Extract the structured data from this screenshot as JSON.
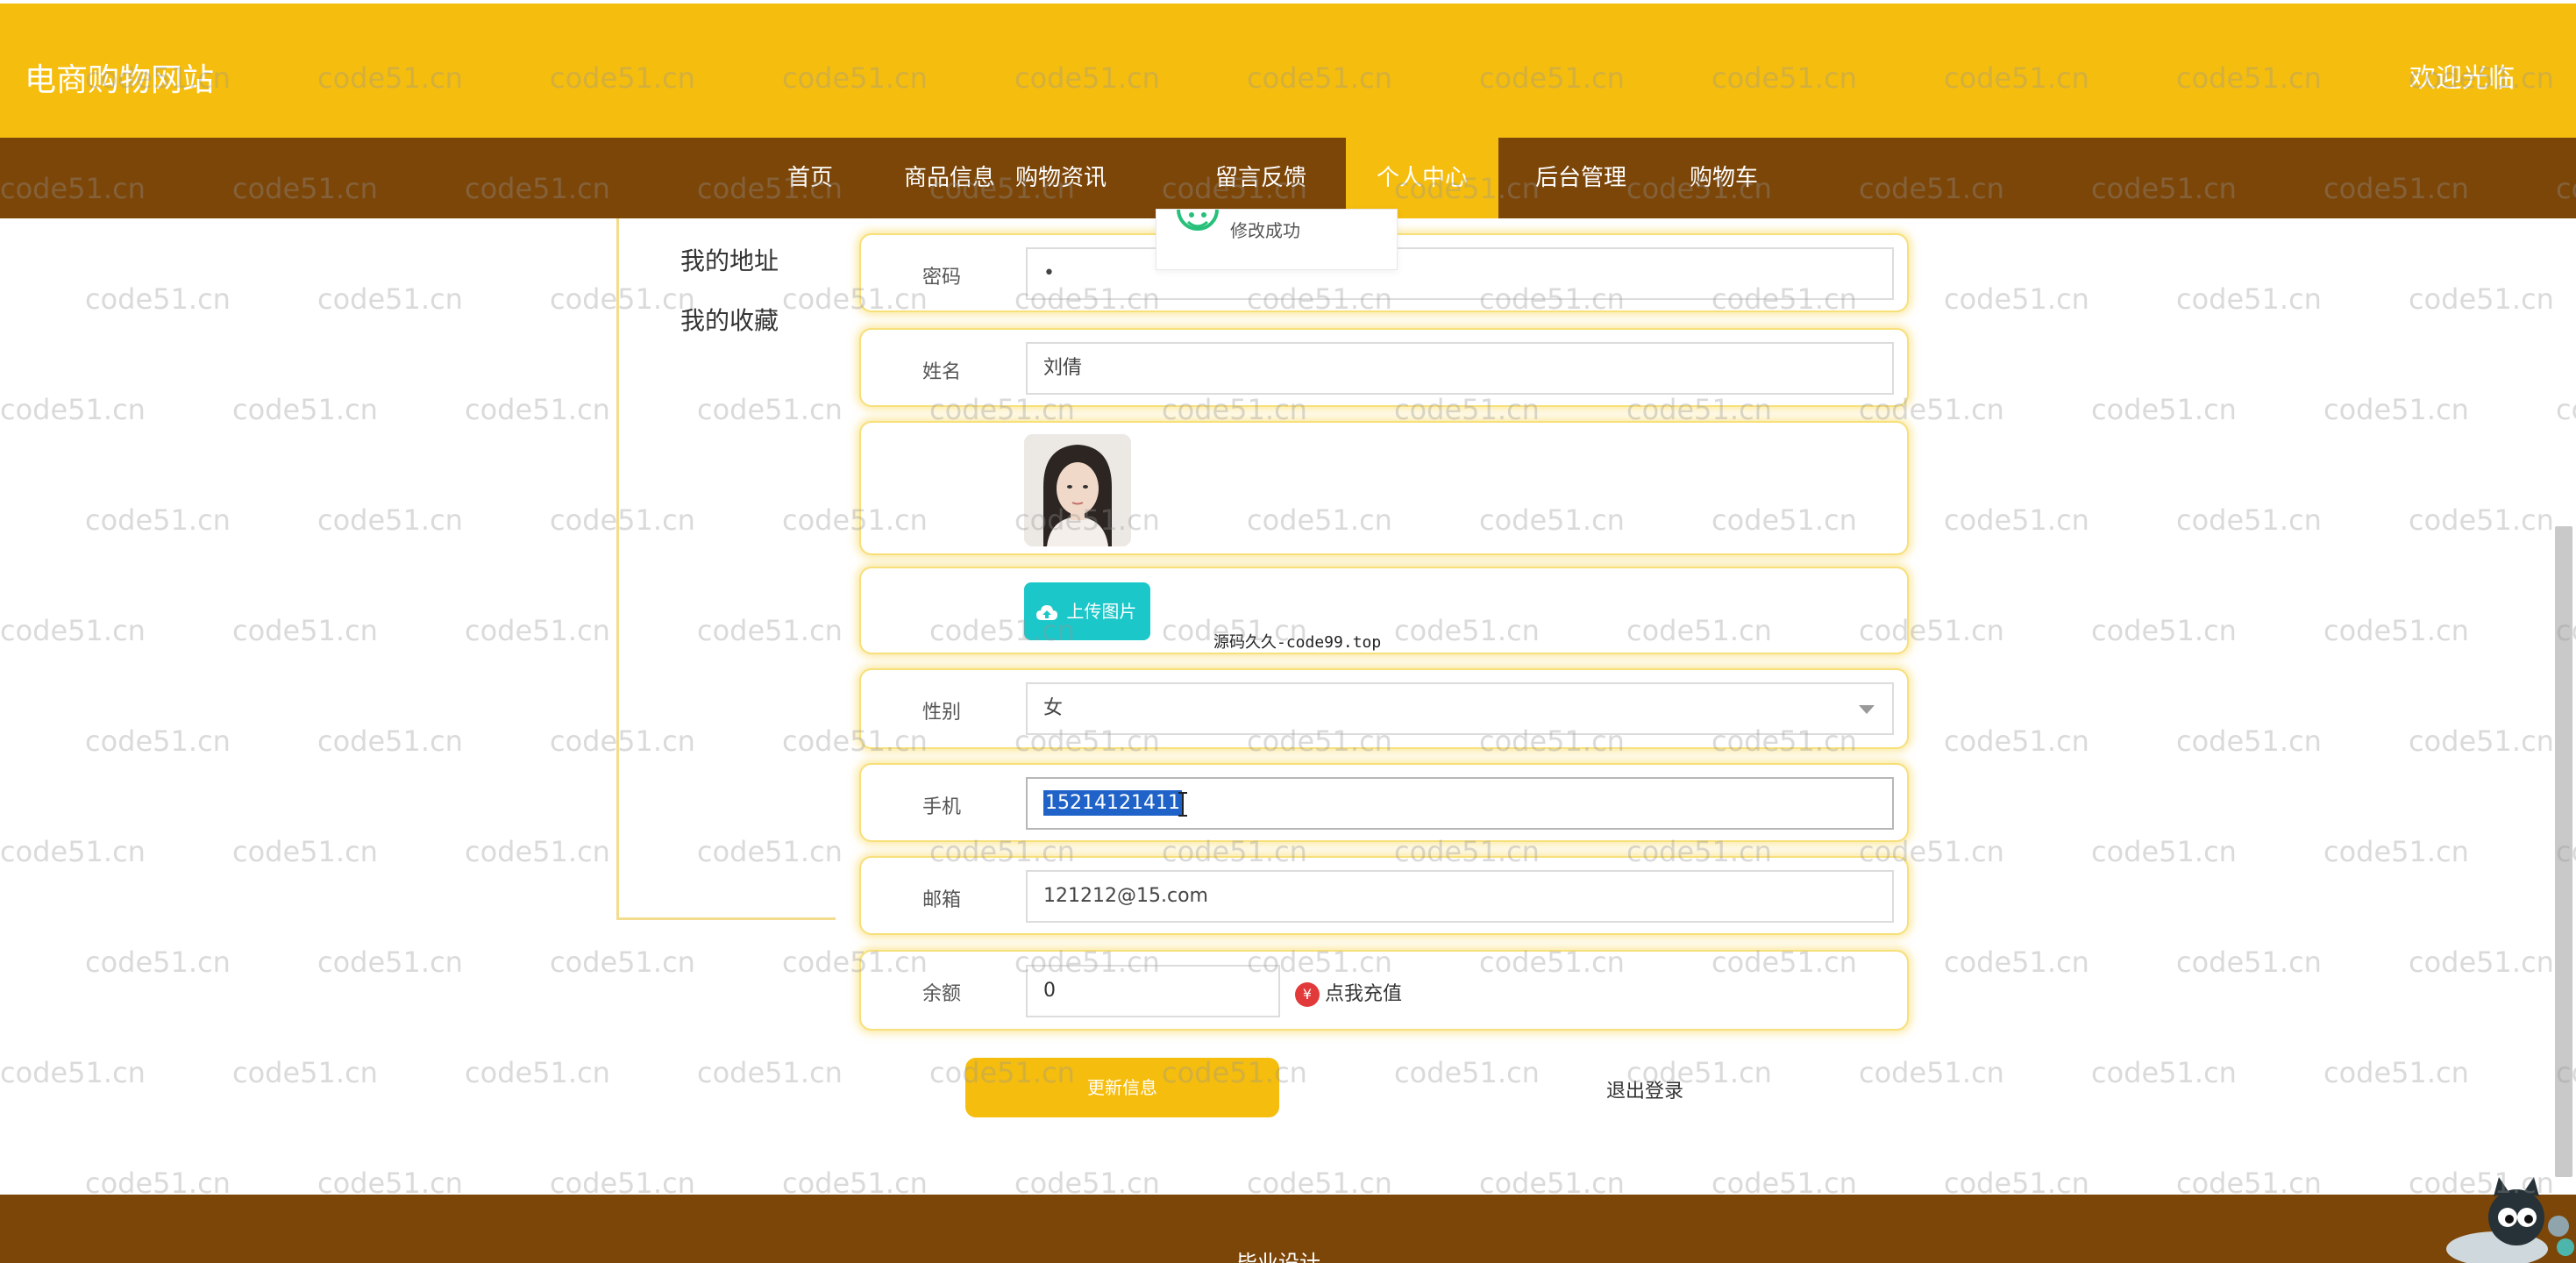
{
  "header": {
    "site_title": "电商购物网站",
    "welcome": "欢迎光临"
  },
  "nav": {
    "items": [
      {
        "label": "首页"
      },
      {
        "label": "商品信息"
      },
      {
        "label": "购物资讯"
      },
      {
        "label": "留言反馈"
      },
      {
        "label": "个人中心",
        "active": true
      },
      {
        "label": "后台管理"
      },
      {
        "label": "购物车"
      }
    ]
  },
  "sidebar": {
    "items": [
      {
        "label": "我的地址"
      },
      {
        "label": "我的收藏"
      }
    ]
  },
  "toast": {
    "message": "修改成功",
    "icon": "smile-icon"
  },
  "form": {
    "password": {
      "label": "密码",
      "value": "•"
    },
    "name": {
      "label": "姓名",
      "value": "刘倩"
    },
    "upload": {
      "button_label": "上传图片",
      "icon": "cloud-upload-icon"
    },
    "caption": "源码久久-code99.top",
    "gender": {
      "label": "性别",
      "value": "女"
    },
    "phone": {
      "label": "手机",
      "value": "15214121411"
    },
    "email": {
      "label": "邮箱",
      "value": "121212@15.com"
    },
    "balance": {
      "label": "余额",
      "value": "0",
      "recharge_label": "点我充值",
      "recharge_icon_glyph": "¥"
    },
    "update_button": "更新信息",
    "logout": "退出登录"
  },
  "footer": {
    "text": "毕业设计"
  },
  "watermark": {
    "text": "code51.cn"
  },
  "colors": {
    "header_bg": "#f5bd0e",
    "nav_bg": "#7c4609",
    "accent": "#1cc7c9",
    "recharge": "#e23a3a"
  }
}
